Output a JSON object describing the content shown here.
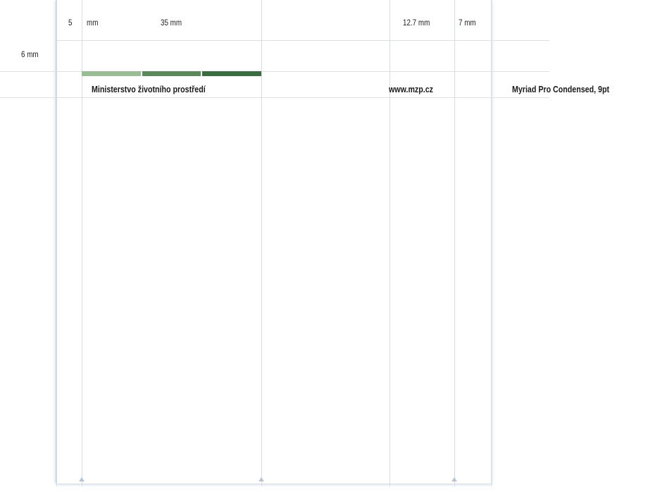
{
  "dimensions": {
    "margin_left": "5",
    "margin_left_unit": "mm",
    "column_width": "35 mm",
    "right_block": "12.7 mm",
    "right_margin": "7 mm",
    "top_margin": "6 mm"
  },
  "header": {
    "ministry_name": "Ministerstvo životního prostředí",
    "website": "www.mzp.cz"
  },
  "font_note": "Myriad Pro Condensed, 9pt",
  "colors": {
    "bar_light": "#9bbd95",
    "bar_mid": "#5c8a5d",
    "bar_dark": "#3b6d40",
    "guide_line": "#d6dce3"
  }
}
